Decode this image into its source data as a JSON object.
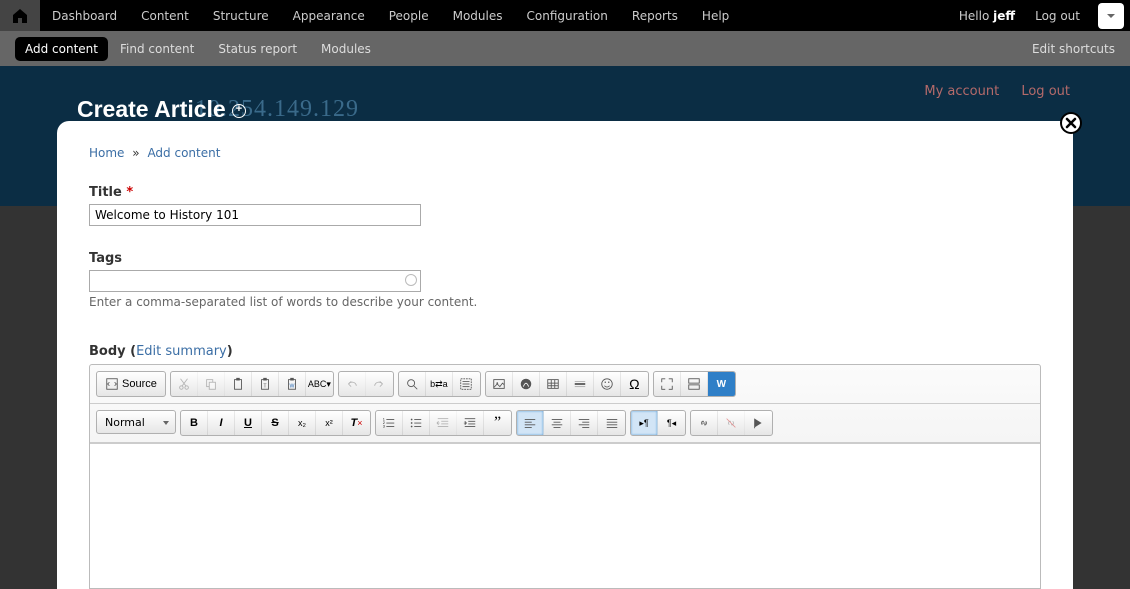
{
  "admin": {
    "menu": [
      "Dashboard",
      "Content",
      "Structure",
      "Appearance",
      "People",
      "Modules",
      "Configuration",
      "Reports",
      "Help"
    ],
    "hello_prefix": "Hello ",
    "username": "jeff",
    "logout": "Log out"
  },
  "shortcuts": {
    "items": [
      "Add content",
      "Find content",
      "Status report",
      "Modules"
    ],
    "active_index": 0,
    "edit": "Edit shortcuts"
  },
  "header": {
    "title": "Create Article",
    "bg_ip": "10.254.149.129",
    "user_links": [
      "My account",
      "Log out"
    ]
  },
  "breadcrumb": {
    "home": "Home",
    "sep": "»",
    "current": "Add content"
  },
  "form": {
    "title_label": "Title",
    "title_value": "Welcome to History 101",
    "tags_label": "Tags",
    "tags_value": "",
    "tags_desc": "Enter a comma-separated list of words to describe your content.",
    "body_label_pre": "Body (",
    "body_edit_summary": "Edit summary",
    "body_label_post": ")"
  },
  "editor": {
    "source": "Source",
    "format": "Normal",
    "icons_row1": [
      "cut",
      "copy",
      "paste",
      "paste-text",
      "paste-word",
      "spellcheck",
      "undo",
      "redo",
      "find",
      "replace",
      "selectall",
      "image",
      "flash",
      "table",
      "hr",
      "smiley",
      "specialchar",
      "maximize",
      "showblocks",
      "w"
    ],
    "icons_row2": [
      "bold",
      "italic",
      "underline",
      "strike",
      "subscript",
      "superscript",
      "removeformat",
      "numberedlist",
      "bulletedlist",
      "outdent",
      "indent",
      "blockquote",
      "justifyleft",
      "justifycenter",
      "justifyright",
      "justifyblock",
      "ltr",
      "rtl",
      "link",
      "unlink",
      "flag"
    ]
  }
}
